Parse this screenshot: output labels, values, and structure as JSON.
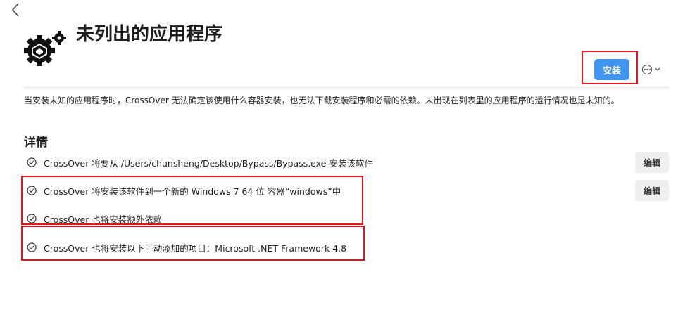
{
  "header": {
    "title": "未列出的应用程序",
    "install_label": "安装"
  },
  "description": "当安装未知的应用程序时，CrossOver 无法确定该使用什么容器安装，也无法下载安装程序和必需的依赖。未出现在列表里的应用程序的运行情况也是未知的。",
  "details": {
    "title": "详情",
    "edit_label": "编辑",
    "items": [
      {
        "text": "CrossOver 将要从 /Users/chunsheng/Desktop/Bypass/Bypass.exe 安装该软件"
      },
      {
        "text": "CrossOver 将安装该软件到一个新的 Windows 7 64 位 容器“windows”中"
      },
      {
        "text": "CrossOver 也将安装额外依赖"
      },
      {
        "text": "CrossOver 也将安装以下手动添加的项目：Microsoft .NET Framework 4.8"
      }
    ]
  },
  "colors": {
    "accent": "#3f95ef",
    "highlight": "#e3141c"
  }
}
